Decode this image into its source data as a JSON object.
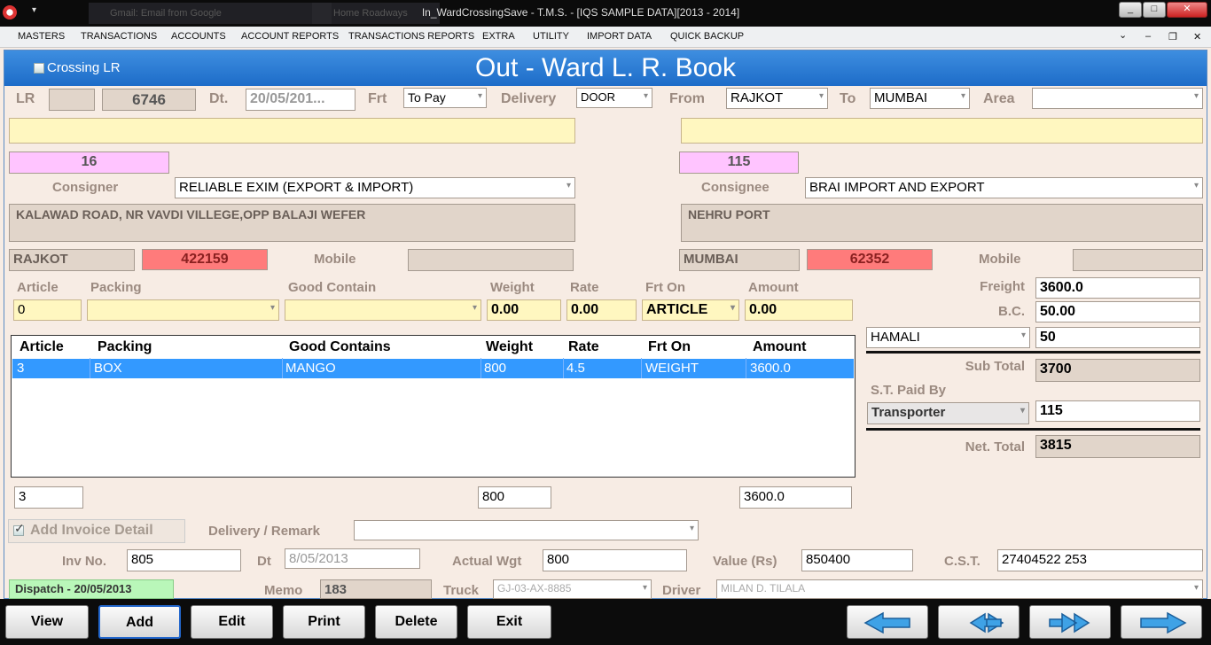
{
  "window": {
    "title": "In_WardCrossingSave - T.M.S. - [IQS SAMPLE DATA][2013 - 2014]",
    "bg_tabs": [
      "Gmail: Email from Google",
      "Home Roadways"
    ]
  },
  "menu": [
    "MASTERS",
    "TRANSACTIONS",
    "ACCOUNTS",
    "ACCOUNT REPORTS",
    "TRANSACTIONS REPORTS",
    "EXTRA",
    "UTILITY",
    "IMPORT DATA",
    "QUICK BACKUP"
  ],
  "form": {
    "crossing_lr": "Crossing LR",
    "title": "Out - Ward L. R. Book",
    "lr_label": "LR",
    "lr_no": "6746",
    "dt_label": "Dt.",
    "date": "20/05/201...",
    "frt_label": "Frt",
    "frt": "To Pay",
    "delivery_label": "Delivery",
    "delivery": "DOOR",
    "from_label": "From",
    "from": "RAJKOT",
    "to_label": "To",
    "to": "MUMBAI",
    "area_label": "Area",
    "area": ""
  },
  "consigner": {
    "code": "16",
    "label": "Consigner",
    "name": "RELIABLE EXIM (EXPORT & IMPORT)",
    "address": "KALAWAD ROAD, NR VAVDI VILLEGE,OPP BALAJI WEFER",
    "city": "RAJKOT",
    "pin": "422159",
    "mobile_label": "Mobile",
    "mobile": ""
  },
  "consignee": {
    "code": "115",
    "label": "Consignee",
    "name": "BRAI IMPORT AND EXPORT",
    "address": "NEHRU PORT",
    "city": "MUMBAI",
    "pin": "62352",
    "mobile_label": "Mobile",
    "mobile": ""
  },
  "entry": {
    "labels": {
      "article": "Article",
      "packing": "Packing",
      "good": "Good Contain",
      "weight": "Weight",
      "rate": "Rate",
      "frton": "Frt On",
      "amount": "Amount"
    },
    "article": "0",
    "packing": "",
    "good": "",
    "weight": "0.00",
    "rate": "0.00",
    "frton": "ARTICLE",
    "amount": "0.00"
  },
  "grid": {
    "headers": [
      "Article",
      "Packing",
      "Good Contains",
      "Weight",
      "Rate",
      "Frt On",
      "Amount"
    ],
    "rows": [
      [
        "3",
        "BOX",
        "MANGO",
        "800",
        "4.5",
        "WEIGHT",
        "3600.0"
      ]
    ]
  },
  "totals_row": {
    "article": "3",
    "weight": "800",
    "amount": "3600.0"
  },
  "charges": {
    "freight_label": "Freight",
    "freight": "3600.0",
    "bc_label": "B.C.",
    "bc": "50.00",
    "hamali_label": "HAMALI",
    "hamali": "50",
    "subtotal_label": "Sub Total",
    "subtotal": "3700",
    "st_paid_label": "S.T. Paid By",
    "st_paid_by": "Transporter",
    "st": "115",
    "net_label": "Net. Total",
    "net": "3815"
  },
  "invoice": {
    "add_label": "Add Invoice Detail",
    "delivery_remark_label": "Delivery / Remark",
    "delivery_remark": "",
    "inv_no_label": "Inv No.",
    "inv_no": "805",
    "dt_label": "Dt",
    "dt": "8/05/2013",
    "actual_wgt_label": "Actual Wgt",
    "actual_wgt": "800",
    "value_label": "Value (Rs)",
    "value": "850400",
    "cst_label": "C.S.T.",
    "cst": "27404522 253"
  },
  "dispatch": {
    "status": "Dispatch - 20/05/2013",
    "memo_label": "Memo",
    "memo": "183",
    "truck_label": "Truck",
    "truck": "GJ-03-AX-8885",
    "driver_label": "Driver",
    "driver": "MILAN D. TILALA"
  },
  "buttons": {
    "view": "View",
    "add": "Add",
    "edit": "Edit",
    "print": "Print",
    "delete": "Delete",
    "exit": "Exit"
  },
  "nav_icons": [
    "arrow-left-icon",
    "double-arrow-left-icon",
    "double-arrow-right-icon",
    "arrow-right-icon"
  ],
  "colors": {
    "header": "#1d6cc8",
    "selection": "#3399ff",
    "pin": "#ff7b7b",
    "code": "#ffc4ff",
    "yellow": "#fff7c0"
  }
}
